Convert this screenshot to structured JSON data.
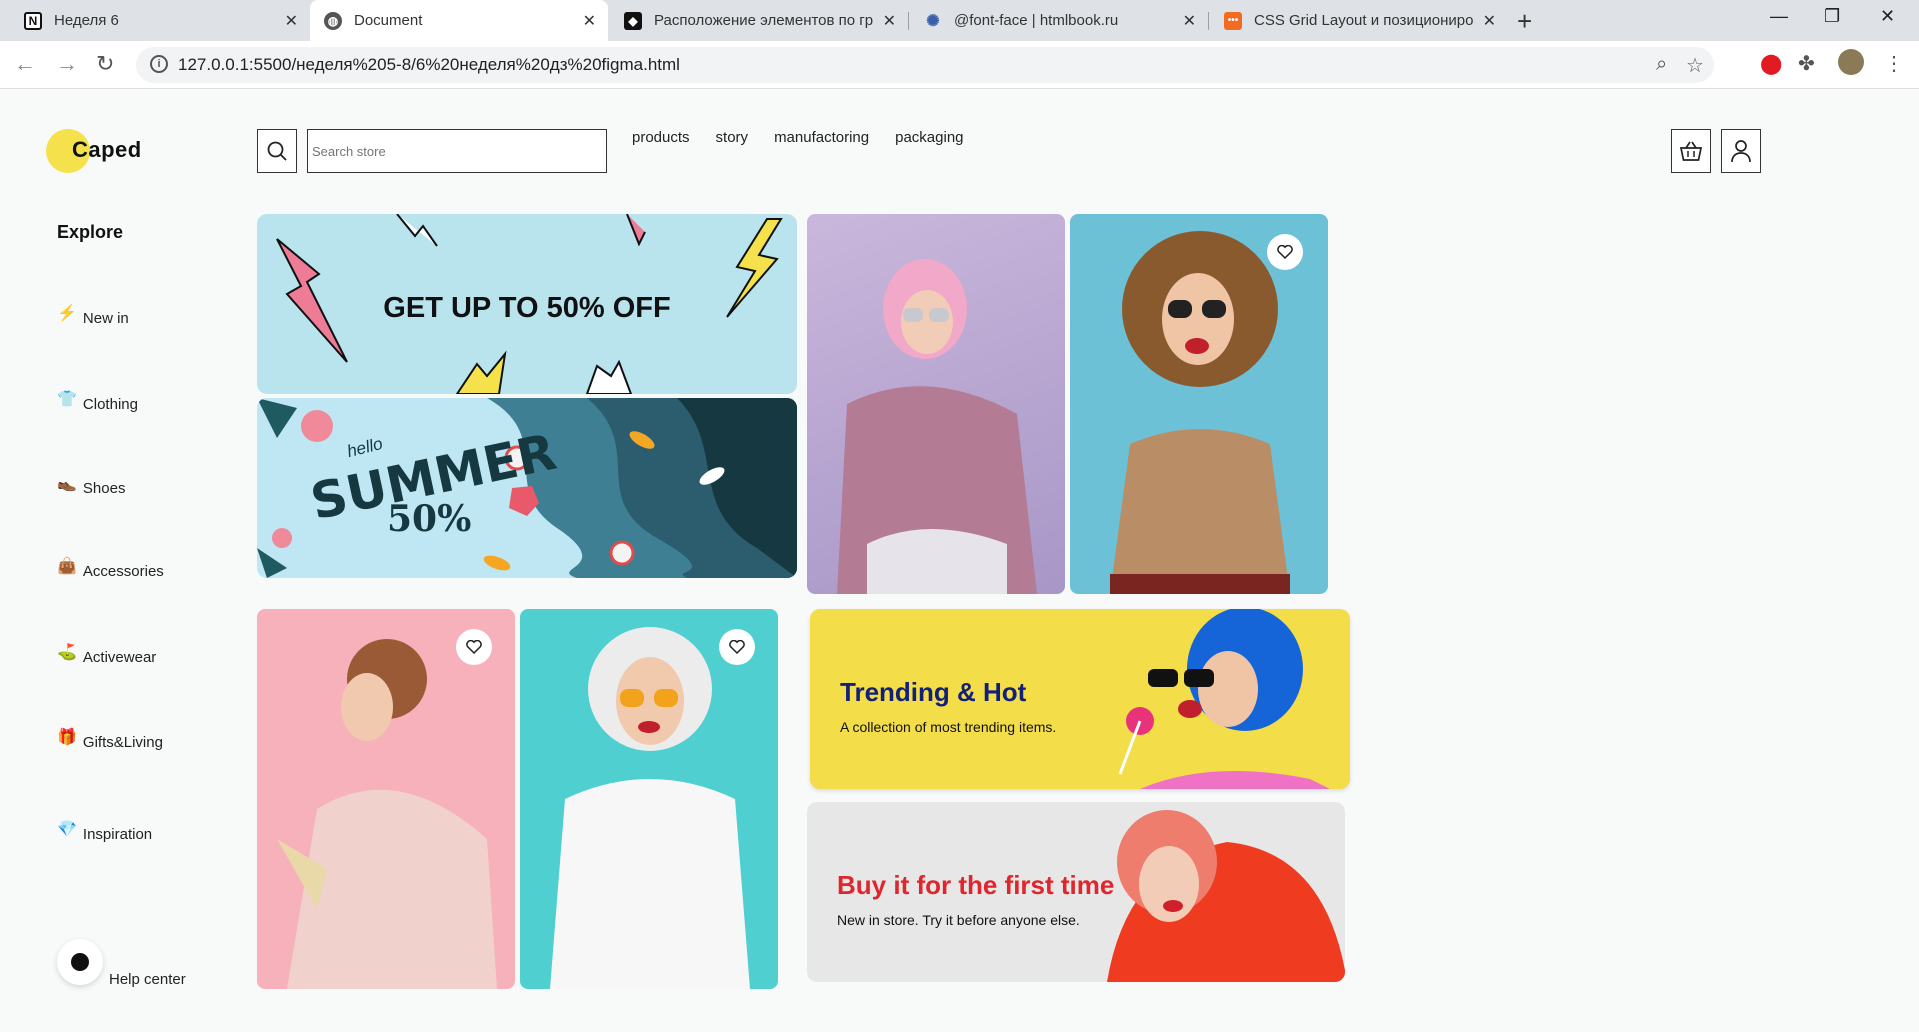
{
  "browser": {
    "tabs": [
      {
        "title": "Неделя 6",
        "favicon": "notion-icon"
      },
      {
        "title": "Document",
        "favicon": "globe-icon"
      },
      {
        "title": "Расположение элементов по гр",
        "favicon": "bookmark-icon"
      },
      {
        "title": "@font-face | htmlbook.ru",
        "favicon": "htmlbook-icon"
      },
      {
        "title": "CSS Grid Layout и позициониро",
        "favicon": "orange-site-icon"
      }
    ],
    "url": "127.0.0.1:5500/неделя%205-8/6%20неделя%20дз%20figma.html"
  },
  "header": {
    "logo": "Caped",
    "search_placeholder": "Search store",
    "nav": [
      "products",
      "story",
      "manufactoring",
      "packaging"
    ]
  },
  "sidebar": {
    "title": "Explore",
    "items": [
      {
        "label": "New in",
        "icon": "lightning-icon"
      },
      {
        "label": "Clothing",
        "icon": "shirt-icon"
      },
      {
        "label": "Shoes",
        "icon": "shoe-icon"
      },
      {
        "label": "Accessories",
        "icon": "bag-icon"
      },
      {
        "label": "Activewear",
        "icon": "activewear-icon"
      },
      {
        "label": "Gifts&Living",
        "icon": "gift-icon"
      },
      {
        "label": "Inspiration",
        "icon": "gem-icon"
      }
    ],
    "help": "Help center"
  },
  "banners": {
    "sale": "GET UP TO 50% OFF",
    "summer": {
      "hello": "hello",
      "title": "SUMMER",
      "pct": "50%"
    },
    "trending": {
      "title": "Trending & Hot",
      "subtitle": "A collection of most trending items."
    },
    "first_time": {
      "title": "Buy it for the first time",
      "subtitle": "New in store. Try it before anyone else."
    }
  },
  "colors": {
    "accent_yellow": "#f4e14c",
    "trend_title": "#13207a",
    "first_title": "#e0262d"
  }
}
